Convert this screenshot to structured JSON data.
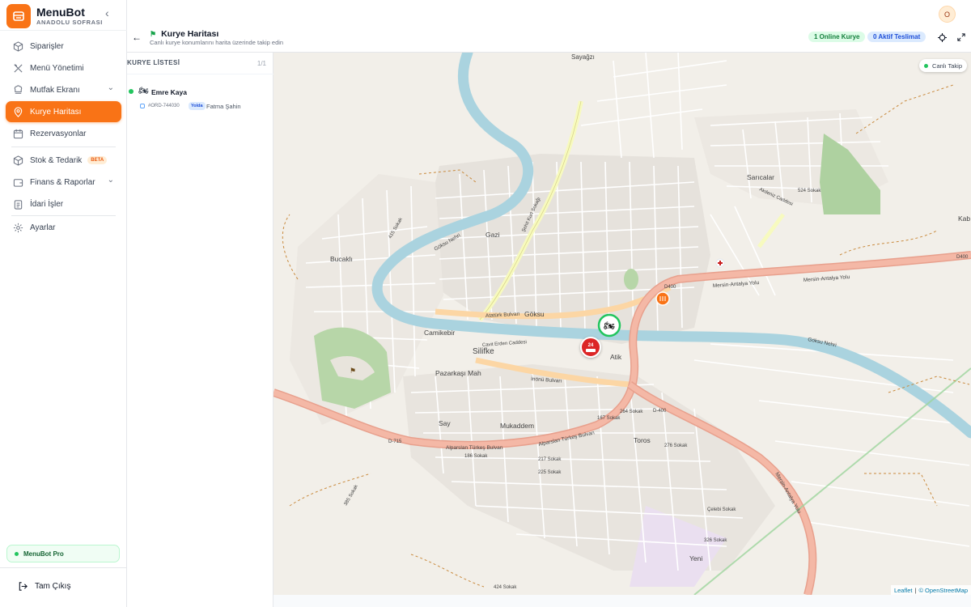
{
  "brand": {
    "name": "MenuBot",
    "subtitle": "ANADOLU SOFRASI"
  },
  "sidebar": {
    "items": [
      {
        "label": "Siparişler"
      },
      {
        "label": "Menü Yönetimi"
      },
      {
        "label": "Mutfak Ekranı"
      },
      {
        "label": "Kurye Haritası"
      },
      {
        "label": "Rezervasyonlar"
      },
      {
        "label": "Stok & Tedarik",
        "badge": "BETA"
      },
      {
        "label": "Finans & Raporlar"
      },
      {
        "label": "İdari İşler"
      },
      {
        "label": "Ayarlar"
      }
    ],
    "plan": "MenuBot Pro",
    "logout": "Tam Çıkış"
  },
  "user": {
    "initial": "O"
  },
  "header": {
    "title": "Kurye Haritası",
    "subtitle": "Canlı kurye konumlarını harita üzerinde takip edin",
    "online_badge": "1 Online Kurye",
    "active_badge": "0 Aktif Teslimat"
  },
  "courier_list": {
    "heading": "KURYE LİSTESİ",
    "count": "1/1",
    "couriers": [
      {
        "name": "Emre Kaya",
        "order": "#ORD-744030",
        "status": "Yolda",
        "customer": "Fatma Şahin"
      }
    ]
  },
  "map": {
    "live_label": "Canlı Takip",
    "attribution_leaflet": "Leaflet",
    "attribution_osm": "© OpenStreetMap",
    "places": {
      "silifke": "Silifke",
      "sayagzi": "Sayağzı",
      "saricalar": "Sarıcalar",
      "bucakli": "Bucaklı",
      "gazi": "Gazi",
      "goksu": "Göksu",
      "camikebir": "Camikebir",
      "pazarkasi": "Pazarkaşı Mah",
      "atik": "Atik",
      "say": "Say",
      "mukaddem": "Mukaddem",
      "toros": "Toros",
      "yeni": "Yeni",
      "kab": "Kab"
    },
    "roads": {
      "mersin1": "Mersin-Antalya Yolu",
      "mersin2": "Mersin-Antalya Yolu",
      "mersin3": "Mersin-Antalya Yolu",
      "d400a": "D400",
      "d400b": "D400",
      "d400c": "D-400",
      "d715": "D-715",
      "ataturk": "Atatürk Bulvarı",
      "inonu": "İnönü Bulvarı",
      "alparslan1": "Alparslan Türkeş Bulvarı",
      "alparslan2": "Alparslan Türkeş Bulvarı",
      "goksunehri": "Göksu Nehri",
      "goksunehri2": "Göksu Nehri",
      "sehit": "Şehit Kurt Sokağı",
      "akdeniz": "Akdeniz Caddesi",
      "cavit": "Cavit Erden Caddesi",
      "sokak524": "524 Sokak",
      "sokak326": "326 Sokak",
      "sokak424": "424 Sokak",
      "sokak186": "186 Sokak",
      "sokak217": "217 Sokak",
      "sokak225": "225 Sokak",
      "sokak264": "264 Sokak",
      "sokak167": "167 Sokak",
      "sokak276": "276 Sokak",
      "sokak415": "415 Sokak",
      "sokak385": "385 Sokak",
      "celebi": "Çelebi Sokak"
    },
    "restaurant_marker": "24"
  }
}
